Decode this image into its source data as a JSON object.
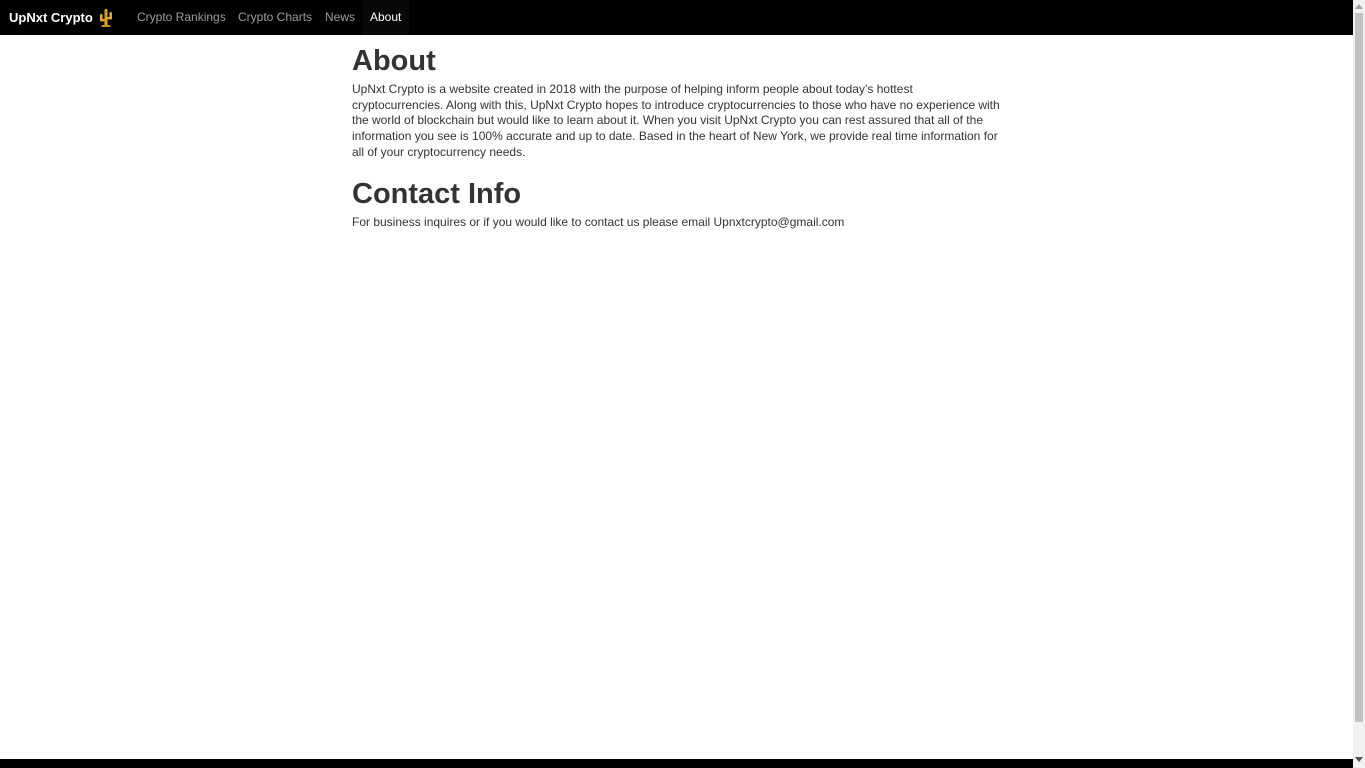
{
  "navbar": {
    "brand": "UpNxt Crypto",
    "links": [
      {
        "label": "Crypto Rankings",
        "active": false
      },
      {
        "label": "Crypto Charts",
        "active": false
      },
      {
        "label": "News",
        "active": false
      },
      {
        "label": "About",
        "active": true
      }
    ]
  },
  "about": {
    "title": "About",
    "body": "UpNxt Crypto is a website created in 2018 with the purpose of helping inform people about today’s hottest cryptocurrencies. Along with this, UpNxt Crypto hopes to introduce cryptocurrencies to those who have no experience with the world of blockchain but would like to learn about it. When you visit UpNxt Crypto you can rest assured that all of the information you see is 100% accurate and up to date. Based in the heart of New York, we provide real time information for all of your cryptocurrency needs."
  },
  "contact": {
    "title": "Contact Info",
    "body": "For business inquires or if you would like to contact us please email Upnxtcrypto@gmail.com"
  },
  "icons": {
    "brand_logo": "cactus-logo-icon"
  },
  "colors": {
    "navbar_bg": "#000000",
    "nav_link": "#9d9d9d",
    "nav_link_active": "#ffffff",
    "text": "#333333",
    "logo": "#e0a82e"
  }
}
